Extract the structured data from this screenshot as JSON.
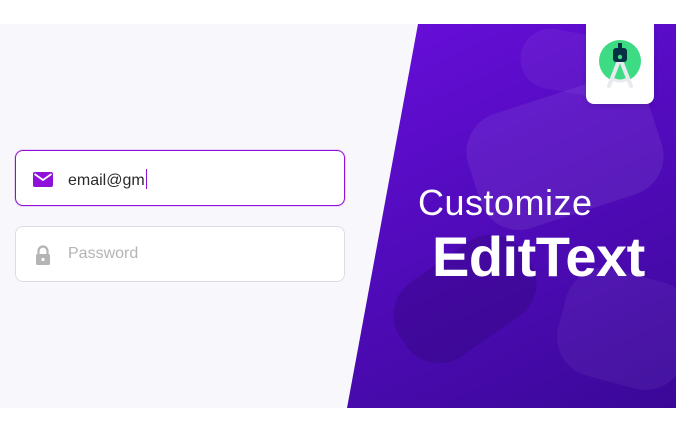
{
  "email_field": {
    "value": "email@gm",
    "icon": "mail-icon",
    "accent_color": "#8f10d8"
  },
  "password_field": {
    "placeholder": "Password",
    "icon": "lock-icon",
    "icon_color": "#b4b4b4"
  },
  "banner": {
    "line1": "Customize",
    "line2": "EditText",
    "gradient_start": "#7a10f0",
    "gradient_end": "#3a0898"
  },
  "logo": {
    "icon": "android-studio-icon",
    "color": "#3ddc84"
  }
}
